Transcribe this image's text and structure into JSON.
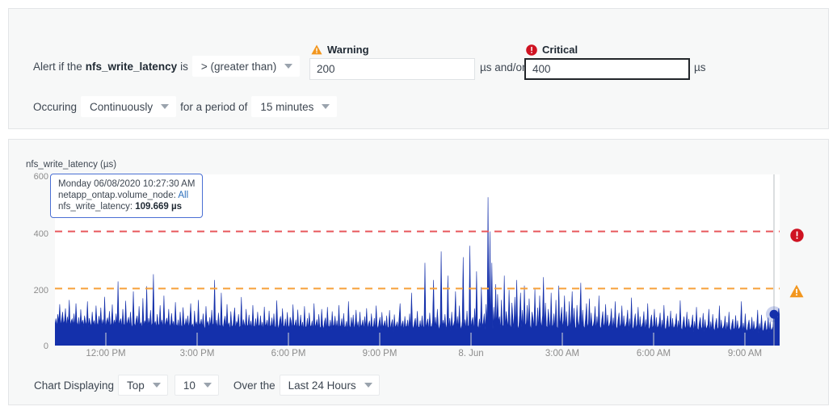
{
  "alert": {
    "prefix_text": "Alert if the",
    "metric": "nfs_write_latency",
    "is_text": "is",
    "operator": "> (greater than)",
    "warning": {
      "label": "Warning",
      "icon": "warning-triangle-icon",
      "value": "200",
      "unit": "µs and/or",
      "color": "#f2961e"
    },
    "critical": {
      "label": "Critical",
      "icon": "critical-circle-icon",
      "value": "400",
      "unit": "µs",
      "color": "#cf1322"
    },
    "occurring_label": "Occuring",
    "occurrence": "Continuously",
    "period_label": "for a period of",
    "period": "15 minutes"
  },
  "chart_controls": {
    "displaying_label": "Chart Displaying",
    "rank": "Top",
    "count": "10",
    "over_the_label": "Over the",
    "range": "Last 24 Hours"
  },
  "tooltip": {
    "timestamp": "Monday 06/08/2020 10:27:30 AM",
    "series_label": "netapp_ontap.volume_node:",
    "series_value": "All",
    "metric_label": "nfs_write_latency:",
    "metric_value": "109.669 µs"
  },
  "chart_data": {
    "type": "area",
    "title": "nfs_write_latency (µs)",
    "xlabel": "",
    "ylabel": "nfs_write_latency (µs)",
    "ylim": [
      0,
      600
    ],
    "yticks": [
      0,
      200,
      400,
      600
    ],
    "ytick_labels": [
      "0",
      "200",
      "400",
      "600"
    ],
    "xtick_labels": [
      "12:00 PM",
      "3:00 PM",
      "6:00 PM",
      "9:00 PM",
      "8. Jun",
      "3:00 AM",
      "6:00 AM",
      "9:00 AM"
    ],
    "grid": false,
    "legend_position": "none",
    "series_name": "nfs_write_latency",
    "series_color": "#1430ab",
    "thresholds": [
      {
        "name": "Critical",
        "value": 400,
        "color": "#e8575c",
        "style": "dashed"
      },
      {
        "name": "Warning",
        "value": 200,
        "color": "#f7a13a",
        "style": "dashed"
      }
    ],
    "hover_point": {
      "x_label": "Monday 06/08/2020 10:27:30 AM",
      "value": 109.669,
      "unit": "µs"
    },
    "values": [
      72,
      95,
      68,
      110,
      83,
      145,
      70,
      92,
      118,
      75,
      88,
      130,
      66,
      101,
      78,
      160,
      69,
      86,
      94,
      72,
      112,
      65,
      148,
      82,
      70,
      99,
      61,
      127,
      74,
      90,
      67,
      105,
      83,
      71,
      155,
      64,
      96,
      78,
      68,
      118,
      73,
      88,
      62,
      140,
      80,
      69,
      104,
      75,
      133,
      66,
      92,
      70,
      171,
      63,
      85,
      98,
      72,
      121,
      67,
      79,
      144,
      65,
      90,
      74,
      112,
      68,
      225,
      70,
      86,
      95,
      63,
      128,
      76,
      69,
      157,
      71,
      84,
      100,
      66,
      118,
      73,
      61,
      190,
      78,
      67,
      92,
      105,
      64,
      138,
      72,
      80,
      58,
      166,
      69,
      88,
      75,
      208,
      62,
      96,
      70,
      124,
      67,
      79,
      250,
      71,
      85,
      63,
      110,
      76,
      68,
      141,
      73,
      90,
      59,
      175,
      66,
      82,
      97,
      70,
      128,
      64,
      77,
      113,
      69,
      86,
      60,
      152,
      74,
      68,
      91,
      57,
      118,
      72,
      63,
      134,
      80,
      66,
      95,
      70,
      105,
      61,
      88,
      148,
      67,
      75,
      58,
      122,
      69,
      84,
      62,
      160,
      71,
      77,
      93,
      64,
      112,
      68,
      55,
      138,
      73,
      86,
      60,
      99,
      66,
      125,
      70,
      78,
      230,
      63,
      90,
      57,
      115,
      72,
      67,
      185,
      75,
      61,
      88,
      104,
      59,
      145,
      68,
      80,
      53,
      120,
      71,
      64,
      97,
      133,
      58,
      85,
      74,
      110,
      62,
      69,
      170,
      56,
      92,
      78,
      63,
      128,
      66,
      73,
      108,
      60,
      87,
      55,
      142,
      70,
      64,
      95,
      58,
      118,
      72,
      67,
      105,
      61,
      83,
      54,
      136,
      69,
      75,
      90,
      57,
      122,
      65,
      71,
      98,
      59,
      112,
      68,
      62,
      158,
      74,
      56,
      88,
      103,
      60,
      130,
      70,
      66,
      94,
      53,
      117,
      72,
      61,
      100,
      86,
      58,
      144,
      67,
      73,
      91,
      55,
      126,
      64,
      70,
      108,
      59,
      83,
      52,
      138,
      68,
      62,
      96,
      57,
      115,
      71,
      65,
      87,
      54,
      148,
      63,
      75,
      92,
      58,
      110,
      66,
      60,
      128,
      72,
      56,
      85,
      98,
      51,
      135,
      69,
      64,
      90,
      55,
      120,
      67,
      73,
      104,
      58,
      88,
      53,
      142,
      65,
      70,
      95,
      57,
      113,
      62,
      68,
      86,
      50,
      155,
      71,
      59,
      99,
      64,
      108,
      55,
      77,
      125,
      60,
      84,
      52,
      118,
      66,
      72,
      90,
      56,
      102,
      61,
      131,
      58,
      75,
      87,
      53,
      112,
      68,
      63,
      96,
      55,
      140,
      70,
      58,
      82,
      100,
      51,
      117,
      64,
      73,
      88,
      57,
      105,
      60,
      66,
      124,
      54,
      78,
      92,
      50,
      109,
      62,
      71,
      84,
      56,
      98,
      148,
      59,
      75,
      87,
      52,
      103,
      65,
      68,
      90,
      55,
      112,
      60,
      185,
      72,
      57,
      83,
      96,
      53,
      121,
      66,
      63,
      88,
      56,
      105,
      70,
      58,
      290,
      61,
      78,
      94,
      52,
      115,
      68,
      64,
      86,
      230,
      57,
      100,
      59,
      128,
      71,
      54,
      82,
      330,
      62,
      90,
      67,
      110,
      56,
      75,
      245,
      60,
      96,
      53,
      118,
      65,
      72,
      88,
      190,
      58,
      103,
      61,
      140,
      69,
      55,
      85,
      310,
      63,
      92,
      57,
      122,
      67,
      70,
      350,
      59,
      86,
      99,
      54,
      130,
      64,
      260,
      71,
      58,
      94,
      62,
      205,
      68,
      80,
      112,
      56,
      145,
      60,
      520,
      66,
      400,
      73,
      290,
      57,
      135,
      69,
      215,
      62,
      180,
      84,
      102,
      55,
      160,
      71,
      67,
      245,
      59,
      120,
      88,
      63,
      195,
      74,
      58,
      150,
      96,
      61,
      170,
      65,
      230,
      70,
      56,
      108,
      185,
      64,
      125,
      57,
      210,
      68,
      79,
      142,
      60,
      165,
      72,
      55,
      118,
      96,
      62,
      198,
      66,
      70,
      133,
      58,
      175,
      85,
      63,
      105,
      240,
      57,
      150,
      69,
      61,
      128,
      90,
      54,
      185,
      65,
      73,
      112,
      59,
      160,
      67,
      56,
      210,
      71,
      98,
      135,
      62,
      88,
      175,
      58,
      120,
      64,
      70,
      155,
      55,
      104,
      190,
      60,
      132,
      66,
      57,
      142,
      85,
      63,
      110,
      220,
      54,
      125,
      68,
      59,
      96,
      148,
      61,
      78,
      165,
      56,
      115,
      65,
      70,
      88,
      138,
      53,
      102,
      60,
      175,
      67,
      58,
      92,
      120,
      62,
      80,
      145,
      55,
      108,
      64,
      71,
      86,
      130,
      52,
      98,
      59,
      155,
      66,
      57,
      90,
      115,
      61,
      76,
      140,
      54,
      105,
      63,
      69,
      84,
      125,
      51,
      95,
      58,
      168,
      65,
      56,
      88,
      112,
      60,
      74,
      135,
      53,
      102,
      62,
      68,
      82,
      120,
      50,
      92,
      57,
      148,
      64,
      55,
      86,
      108,
      59,
      72,
      128,
      52,
      99,
      61,
      67,
      80,
      115,
      49,
      90,
      56,
      142,
      63,
      54,
      84,
      105,
      58,
      70,
      122,
      51,
      96,
      60,
      66,
      78,
      112,
      48,
      88,
      55,
      158,
      62,
      53,
      82,
      102,
      57,
      68,
      118,
      50,
      94,
      59,
      65,
      76,
      108,
      47,
      86,
      54,
      135,
      61,
      52,
      80,
      99,
      56,
      66,
      114,
      49,
      92,
      58,
      64,
      74,
      128,
      46,
      84,
      53,
      110,
      60,
      51,
      78,
      96,
      55,
      64,
      140,
      48,
      90,
      57,
      63,
      72,
      104,
      45,
      82,
      52,
      118,
      59,
      50,
      76,
      93,
      54,
      62,
      106,
      47,
      88,
      56,
      61,
      70,
      155,
      44,
      80,
      51,
      112,
      58,
      49,
      74,
      90,
      53,
      60,
      100,
      46,
      86,
      55,
      59,
      68,
      125,
      43,
      78,
      50,
      108,
      57,
      48,
      72,
      88,
      52,
      58,
      98,
      45,
      84,
      54,
      57,
      66,
      115,
      110,
      95,
      120,
      88,
      130,
      102
    ]
  }
}
